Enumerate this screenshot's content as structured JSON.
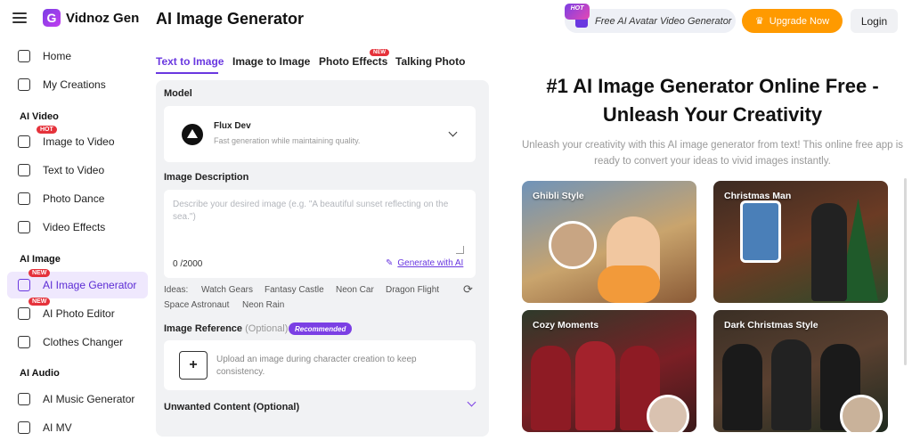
{
  "app": {
    "logo_text": "Vidnoz Gen",
    "logo_letter": "G"
  },
  "sidebar": {
    "items": [
      {
        "label": "Home"
      },
      {
        "label": "My Creations"
      },
      {
        "section": "AI Video"
      },
      {
        "label": "Image to Video",
        "badge": "HOT"
      },
      {
        "label": "Text to Video"
      },
      {
        "label": "Photo Dance"
      },
      {
        "label": "Video Effects"
      },
      {
        "section": "AI Image"
      },
      {
        "label": "AI Image Generator",
        "badge": "NEW"
      },
      {
        "label": "AI Photo Editor",
        "badge": "NEW"
      },
      {
        "label": "Clothes Changer"
      },
      {
        "section": "AI Audio"
      },
      {
        "label": "AI Music Generator"
      },
      {
        "label": "AI MV"
      }
    ]
  },
  "header": {
    "title": "AI Image Generator",
    "promo_badge": "HOT",
    "promo_label": "Free AI Avatar Video Generator",
    "upgrade_label": "Upgrade Now",
    "login_label": "Login"
  },
  "tabs": [
    {
      "label": "Text to Image"
    },
    {
      "label": "Image to Image"
    },
    {
      "label": "Photo Effects",
      "badge": "NEW"
    },
    {
      "label": "Talking Photo"
    }
  ],
  "form": {
    "model_label": "Model",
    "model_name": "Flux Dev",
    "model_desc": "Fast generation while maintaining quality.",
    "desc_label": "Image Description",
    "desc_placeholder": "Describe your desired image (e.g. \"A beautiful sunset reflecting on the sea.\")",
    "char_count": "0 /2000",
    "generate_ai": "Generate with AI",
    "ideas_label": "Ideas:",
    "ideas": [
      "Watch Gears",
      "Fantasy Castle",
      "Neon Car",
      "Dragon Flight",
      "Space Astronaut",
      "Neon Rain"
    ],
    "ref_label": "Image Reference",
    "ref_optional": "(Optional)",
    "ref_badge": "Recommended",
    "upload_plus": "+",
    "upload_text": "Upload an image during character creation to keep consistency.",
    "unwanted_label": "Unwanted Content (Optional)"
  },
  "hero": {
    "title_line1": "#1 AI Image Generator Online Free -",
    "title_line2": "Unleash Your Creativity",
    "subtitle": "Unleash your creativity with this AI image generator from text! This online free app is ready to convert your ideas to vivid images instantly."
  },
  "examples": [
    {
      "label": "Ghibli Style"
    },
    {
      "label": "Christmas Man"
    },
    {
      "label": "Cozy Moments"
    },
    {
      "label": "Dark Christmas Style"
    }
  ],
  "colors": {
    "accent": "#6a38e0",
    "upgrade": "#ff9a00",
    "hot": "#e5323b",
    "panel": "#f1f2f4"
  }
}
